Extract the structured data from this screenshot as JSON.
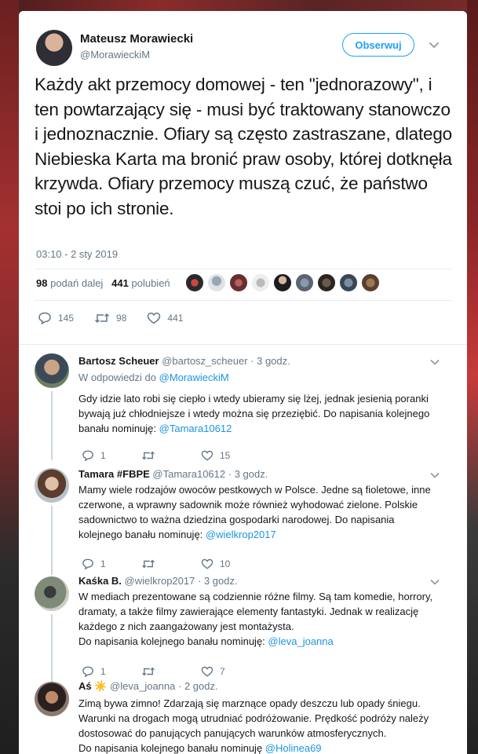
{
  "main_tweet": {
    "author_name": "Mateusz Morawiecki",
    "author_handle": "@MorawieckiM",
    "follow_label": "Obserwuj",
    "text": "Każdy akt przemocy domowej - ten \"jednorazowy\", i ten powtarzający się - musi być traktowany stanowczo i jednoznacznie. Ofiary są często zastraszane, dlatego Niebieska Karta ma bronić praw osoby, której dotknęła krzywda. Ofiary przemocy muszą czuć, że państwo stoi po ich stronie.",
    "time": "03:10 - 2 sty 2019",
    "retweets_count": "98",
    "retweets_label": "podań dalej",
    "likes_count": "441",
    "likes_label": "polubień",
    "reply_count": "145",
    "retweet_action_count": "98",
    "like_action_count": "441"
  },
  "replies": [
    {
      "name": "Bartosz Scheuer",
      "handle": "@bartosz_scheuer",
      "time": "· 3 godz.",
      "in_reply_prefix": "W odpowiedzi do",
      "in_reply_handle": "@MorawieckiM",
      "text": "Gdy idzie lato robi się ciepło i wtedy ubieramy się lżej, jednak jesienią poranki bywają już chłodniejsze i wtedy można się przeziębić. Do napisania kolejnego banału nominuję:",
      "mention": "@Tamara10612",
      "reply_count": "1",
      "retweet_count": "",
      "like_count": "15"
    },
    {
      "name": "Tamara #FBPE",
      "handle": "@Tamara10612",
      "time": "· 3 godz.",
      "text": "Mamy wiele rodzajów owoców pestkowych w Polsce. Jedne są fioletowe, inne czerwone, a wprawny sadownik może również wyhodować zielone. Polskie sadownictwo to ważna dziedzina gospodarki narodowej. Do napisania kolejnego banału nominuję:",
      "mention": "@wielkrop2017",
      "reply_count": "1",
      "retweet_count": "",
      "like_count": "10"
    },
    {
      "name": "Kaśka B.",
      "handle": "@wielkrop2017",
      "time": "· 3 godz.",
      "text": "W mediach prezentowane są codziennie różne filmy. Są tam komedie, horrory, dramaty, a także filmy zawierające elementy fantastyki. Jednak w realizację każdego z nich zaangażowany jest montażysta.",
      "text2": "Do napisania kolejnego banału nominuję:",
      "mention": "@leva_joanna",
      "reply_count": "1",
      "retweet_count": "",
      "like_count": "7"
    },
    {
      "name": "Aś",
      "emoji": "☀️",
      "handle": "@leva_joanna",
      "time": "· 2 godz.",
      "text": "Zimą bywa zimno! Zdarzają się marznące opady deszczu lub opady śniegu. Warunki na drogach mogą utrudniać podróżowanie. Prędkość podróży należy dostosować do panujących panujących warunków atmosferycznych.",
      "text2": "Do napisania kolejnego banału nominuję",
      "mention": "@Holinea69"
    }
  ],
  "icons": {
    "reply": "speech-bubble-icon",
    "retweet": "retweet-arrows-icon",
    "like": "heart-icon",
    "more": "chevron-down-icon"
  },
  "colors": {
    "accent": "#1da1f2",
    "link": "#1b95e0",
    "muted": "#657786",
    "text": "#14171a"
  }
}
